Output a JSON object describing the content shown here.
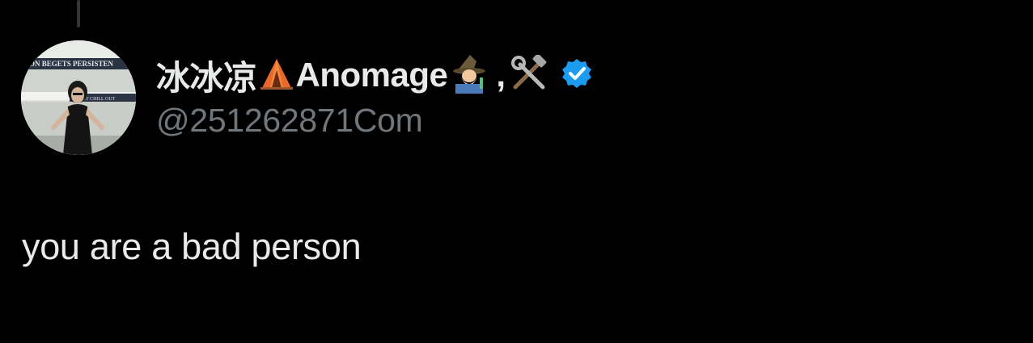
{
  "tweet": {
    "author": {
      "name_part1": "冰冰凉",
      "name_part2": "Anomage",
      "name_separator": ",",
      "handle": "@251262871Com",
      "verified": true,
      "emojis": [
        "tent-icon",
        "mage-icon",
        "hammer-wrench-icon"
      ],
      "avatar_banner_top": "ON BEGETS PERSISTEN",
      "avatar_banner_bottom": "JUST CHILL OUT"
    },
    "text": "you are a bad person"
  },
  "colors": {
    "background": "#000000",
    "text_primary": "#e7e9ea",
    "text_secondary": "#71767b",
    "verified_blue": "#1d9bf0"
  }
}
